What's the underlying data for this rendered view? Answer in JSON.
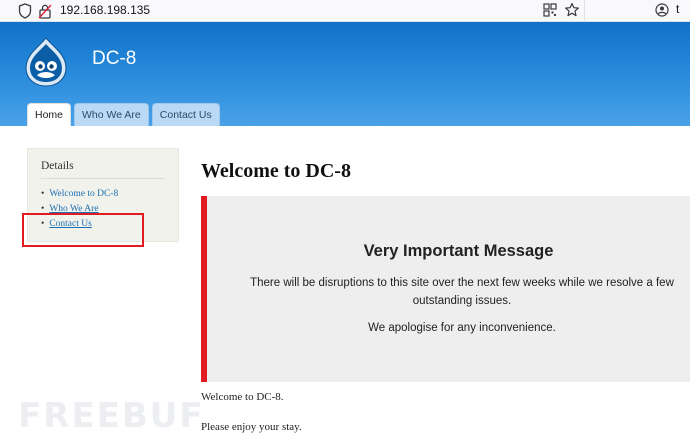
{
  "browser": {
    "url": "192.168.198.135",
    "icons": [
      "shield-icon",
      "lock-icon",
      "qr-code-icon",
      "star-icon",
      "account-icon",
      "more-icon"
    ],
    "more_glyph": "t"
  },
  "site": {
    "name": "DC-8",
    "logo": "drupal-drop-icon",
    "header_color": "#1a7fd4"
  },
  "nav": {
    "tabs": [
      {
        "label": "Home",
        "active": true
      },
      {
        "label": "Who We Are",
        "active": false
      },
      {
        "label": "Contact Us",
        "active": false
      }
    ]
  },
  "sidebar": {
    "title": "Details",
    "items": [
      {
        "label": "Welcome to DC-8"
      },
      {
        "label": "Who We Are"
      },
      {
        "label": "Contact Us"
      }
    ],
    "highlight_color": "#e01b22"
  },
  "main": {
    "title": "Welcome to DC-8",
    "message": {
      "title": "Very Important Message",
      "line1": "There will be disruptions to this site over the next few weeks while we resolve a few",
      "line2": "outstanding issues.",
      "line3": "We apologise for any inconvenience.",
      "accent": "#e01b22"
    },
    "paragraph1": "Welcome to DC-8.",
    "paragraph2": "Please enjoy your stay."
  },
  "watermark": "FREEBUF"
}
